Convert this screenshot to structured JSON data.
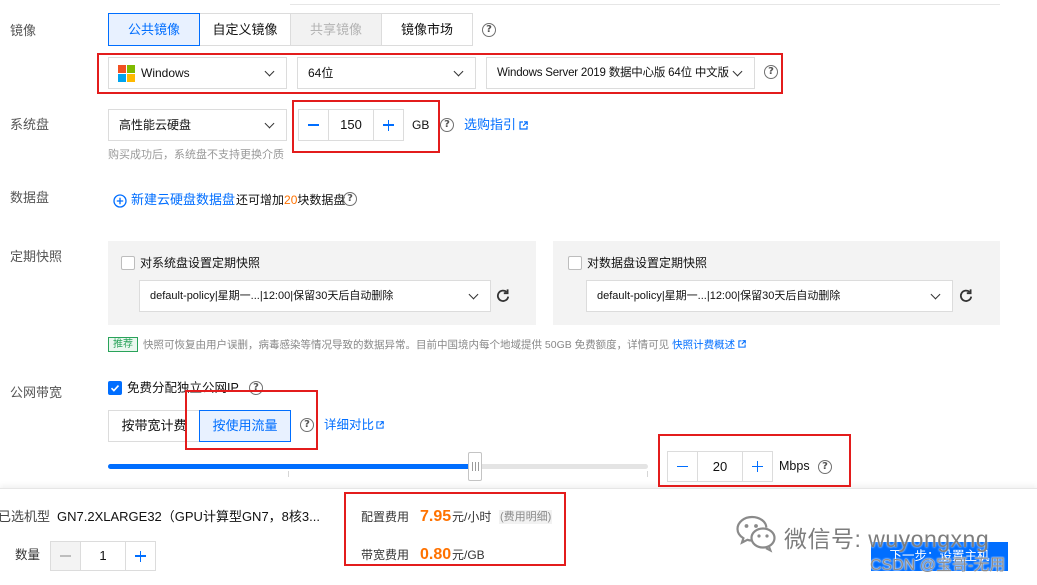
{
  "colors": {
    "primary": "#006eff",
    "price": "#ff7200",
    "annotation": "#e31c1c",
    "recommend": "#29a35a"
  },
  "image": {
    "label": "镜像",
    "tabs": [
      {
        "label": "公共镜像",
        "state": "selected"
      },
      {
        "label": "自定义镜像",
        "state": "normal"
      },
      {
        "label": "共享镜像",
        "state": "disabled"
      },
      {
        "label": "镜像市场",
        "state": "normal"
      }
    ],
    "os": "Windows",
    "os_icon": "windows-logo-icon",
    "architecture": "64位",
    "version": "Windows Server 2019 数据中心版 64位 中文版"
  },
  "system_disk": {
    "label": "系统盘",
    "type": "高性能云硬盘",
    "size": "150",
    "unit": "GB",
    "guide_link": "选购指引",
    "hint": "购买成功后，系统盘不支持更换介质"
  },
  "data_disk": {
    "label": "数据盘",
    "add_link": "新建云硬盘数据盘",
    "remaining_prefix": "还可增加",
    "remaining_count": "20",
    "remaining_suffix": "块数据盘"
  },
  "snapshot": {
    "label": "定期快照",
    "system_disk": {
      "checkbox_label": "对系统盘设置定期快照",
      "checked": false,
      "policy": "default-policy|星期一...|12:00|保留30天后自动删除"
    },
    "data_disk": {
      "checkbox_label": "对数据盘设置定期快照",
      "checked": false,
      "policy": "default-policy|星期一...|12:00|保留30天后自动删除"
    },
    "tag": "推荐",
    "note": "快照可恢复由用户误删，病毒感染等情况导致的数据异常。目前中国境内每个地域提供 50GB 免费额度，详情可见 ",
    "note_link": "快照计费概述"
  },
  "bandwidth": {
    "label": "公网带宽",
    "public_ip_label": "免费分配独立公网IP",
    "public_ip_checked": true,
    "billing_tabs": [
      {
        "label": "按带宽计费",
        "state": "normal"
      },
      {
        "label": "按使用流量",
        "state": "selected"
      }
    ],
    "compare_link": "详细对比",
    "slider_level_percent": 68,
    "value": "20",
    "unit": "Mbps"
  },
  "footer": {
    "model_label": "已选机型",
    "model_value": "GN7.2XLARGE32（GPU计算型GN7，8核3...",
    "quantity_label": "数量",
    "quantity": "1",
    "config_fee_label": "配置费用",
    "config_fee": "7.95",
    "config_fee_unit": "元/小时",
    "fee_detail_link": "(费用明细)",
    "bandwidth_fee_label": "带宽费用",
    "bandwidth_fee": "0.80",
    "bandwidth_fee_unit": "元/GB",
    "next_button": "下一步：设置主机"
  },
  "watermark": {
    "wechat": "微信号: wuyongxng",
    "csdn": "CSDN @宝哥-无用"
  }
}
